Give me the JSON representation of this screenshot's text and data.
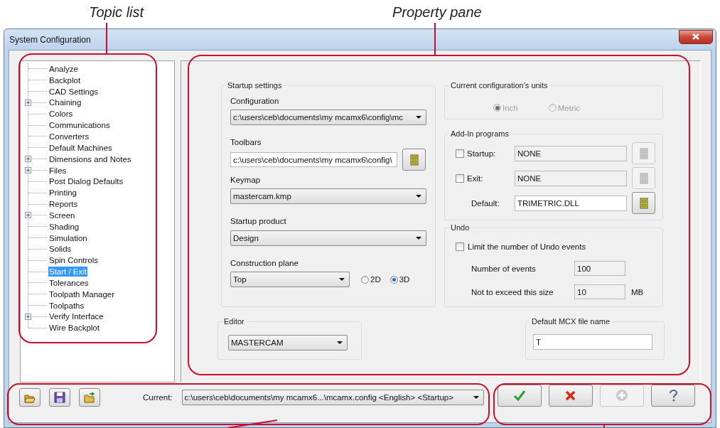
{
  "callouts": [
    {
      "text": "Topic list"
    },
    {
      "text": "Property pane"
    }
  ],
  "window": {
    "title": "System Configuration"
  },
  "topic_list": {
    "items": [
      {
        "label": "Analyze",
        "kind": "leaf",
        "selected": false
      },
      {
        "label": "Backplot",
        "kind": "leaf",
        "selected": false
      },
      {
        "label": "CAD Settings",
        "kind": "leaf",
        "selected": false
      },
      {
        "label": "Chaining",
        "kind": "folder",
        "selected": false
      },
      {
        "label": "Colors",
        "kind": "leaf",
        "selected": false
      },
      {
        "label": "Communications",
        "kind": "leaf",
        "selected": false
      },
      {
        "label": "Converters",
        "kind": "leaf",
        "selected": false
      },
      {
        "label": "Default Machines",
        "kind": "leaf",
        "selected": false
      },
      {
        "label": "Dimensions and Notes",
        "kind": "folder",
        "selected": false
      },
      {
        "label": "Files",
        "kind": "folder",
        "selected": false
      },
      {
        "label": "Post Dialog Defaults",
        "kind": "leaf",
        "selected": false
      },
      {
        "label": "Printing",
        "kind": "leaf",
        "selected": false
      },
      {
        "label": "Reports",
        "kind": "leaf",
        "selected": false
      },
      {
        "label": "Screen",
        "kind": "folder",
        "selected": false
      },
      {
        "label": "Shading",
        "kind": "leaf",
        "selected": false
      },
      {
        "label": "Simulation",
        "kind": "leaf",
        "selected": false
      },
      {
        "label": "Solids",
        "kind": "leaf",
        "selected": false
      },
      {
        "label": "Spin Controls",
        "kind": "leaf",
        "selected": false
      },
      {
        "label": "Start / Exit",
        "kind": "leaf",
        "selected": true
      },
      {
        "label": "Tolerances",
        "kind": "leaf",
        "selected": false
      },
      {
        "label": "Toolpath Manager",
        "kind": "leaf",
        "selected": false
      },
      {
        "label": "Toolpaths",
        "kind": "leaf",
        "selected": false
      },
      {
        "label": "Verify Interface",
        "kind": "folder",
        "selected": false
      },
      {
        "label": "Wire Backplot",
        "kind": "leaf",
        "selected": false
      }
    ]
  },
  "startup_settings": {
    "title": "Startup settings",
    "configuration": {
      "label": "Configuration",
      "value": "c:\\users\\ceb\\documents\\my mcamx6\\config\\mc"
    },
    "toolbars": {
      "label": "Toolbars",
      "value": "c:\\users\\ceb\\documents\\my mcamx6\\config\\"
    },
    "keymap": {
      "label": "Keymap",
      "value": "mastercam.kmp"
    },
    "startup_product": {
      "label": "Startup product",
      "value": "Design"
    },
    "construction_plane": {
      "label": "Construction plane",
      "value": "Top",
      "options": [
        {
          "label": "2D",
          "selected": false
        },
        {
          "label": "3D",
          "selected": true
        }
      ]
    }
  },
  "units": {
    "title": "Current configuration's units",
    "disabled": true,
    "options": [
      {
        "label": "Inch",
        "selected": true
      },
      {
        "label": "Metric",
        "selected": false
      }
    ]
  },
  "add_in_programs": {
    "title": "Add-In programs",
    "rows": [
      {
        "kind": "check",
        "label": "Startup:",
        "checked": false,
        "value": "NONE",
        "disabled": true
      },
      {
        "kind": "check",
        "label": "Exit:",
        "checked": false,
        "value": "NONE",
        "disabled": true
      },
      {
        "kind": "plain",
        "label": "Default:",
        "value": "TRIMETRIC.DLL",
        "disabled": false
      }
    ]
  },
  "undo": {
    "title": "Undo",
    "limit": {
      "label": "Limit the number of Undo events",
      "checked": false
    },
    "number_of_events": {
      "label": "Number of events",
      "value": "100"
    },
    "max_size": {
      "label": "Not to exceed this size",
      "value": "10",
      "unit": "MB"
    }
  },
  "editor": {
    "title": "Editor",
    "value": "MASTERCAM"
  },
  "default_mcx": {
    "title": "Default MCX file name",
    "value": "T"
  },
  "current": {
    "label": "Current:",
    "value": "c:\\users\\ceb\\documents\\my mcamx6...\\mcamx.config <English> <Startup>"
  },
  "actions": [
    {
      "kind": "ok",
      "disabled": false
    },
    {
      "kind": "cancel",
      "disabled": false
    },
    {
      "kind": "add",
      "disabled": true
    },
    {
      "kind": "help",
      "disabled": false
    }
  ]
}
